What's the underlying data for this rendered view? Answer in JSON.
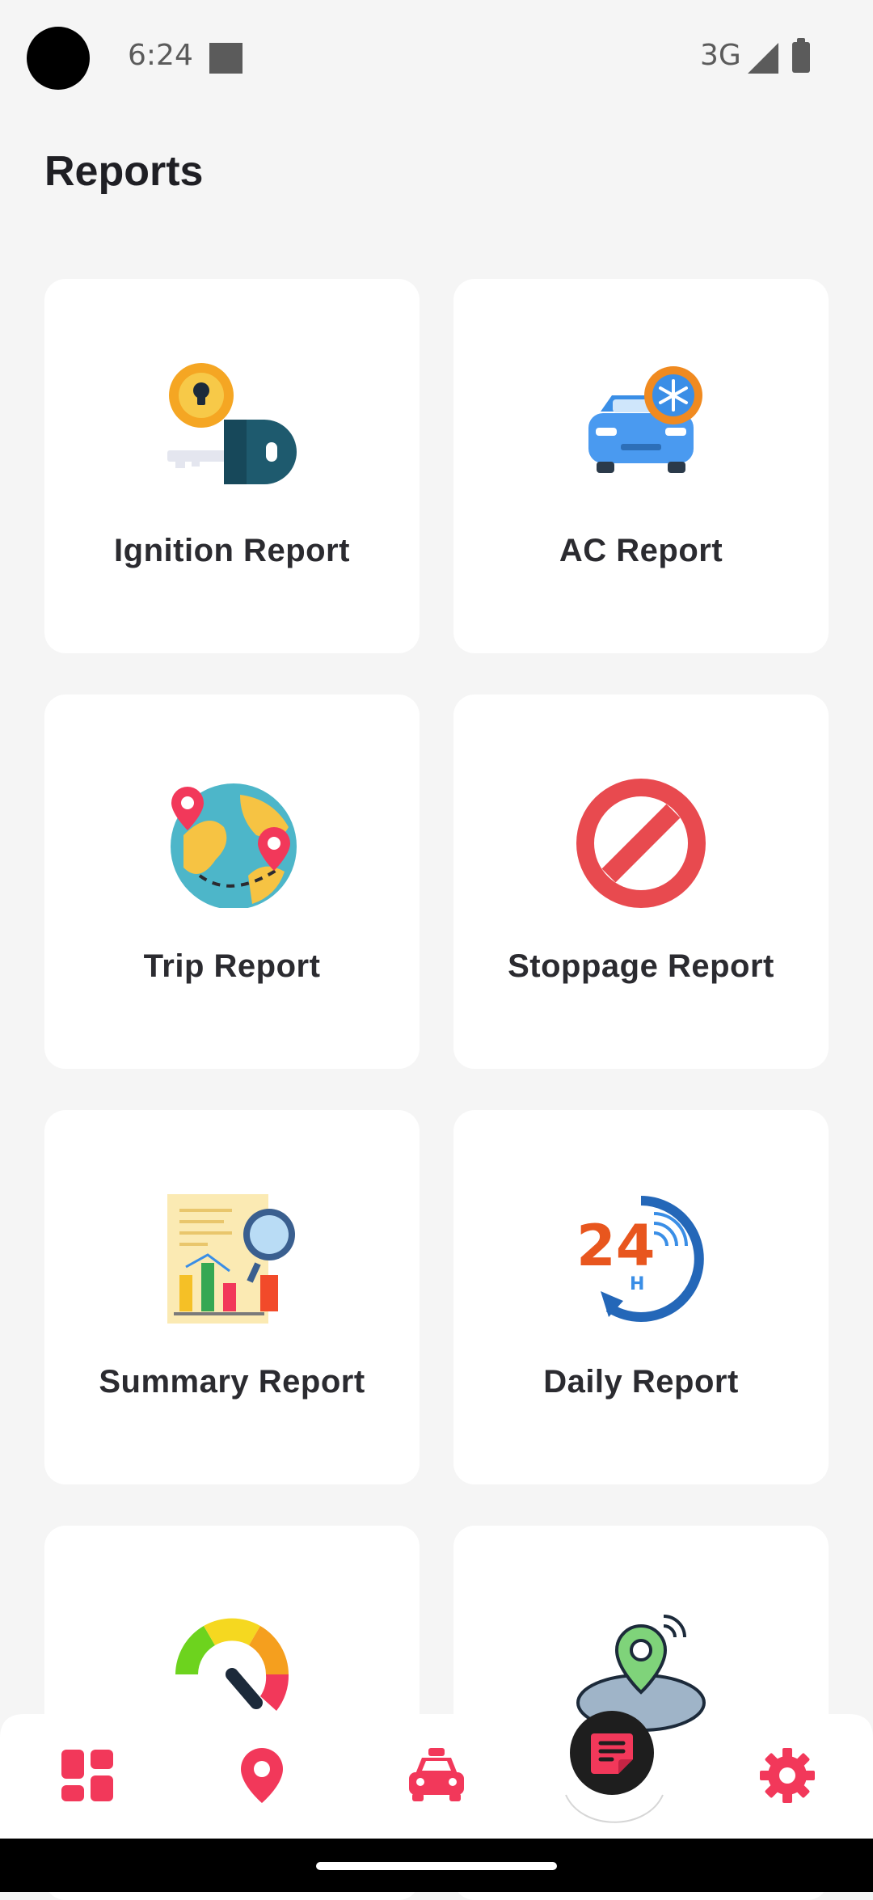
{
  "status_bar": {
    "time": "6:24",
    "network": "3G"
  },
  "page": {
    "title": "Reports"
  },
  "reports": [
    {
      "label": "Ignition Report",
      "icon": "ignition-key-icon"
    },
    {
      "label": "AC Report",
      "icon": "car-ac-icon"
    },
    {
      "label": "Trip Report",
      "icon": "globe-route-icon"
    },
    {
      "label": "Stoppage Report",
      "icon": "stop-sign-icon"
    },
    {
      "label": "Summary Report",
      "icon": "summary-chart-icon"
    },
    {
      "label": "Daily Report",
      "icon": "24-hour-icon"
    },
    {
      "label": "",
      "icon": "speedometer-icon"
    },
    {
      "label": "",
      "icon": "geofence-pin-icon"
    }
  ],
  "bottom_nav": [
    {
      "name": "dashboard",
      "icon": "dashboard-icon"
    },
    {
      "name": "location",
      "icon": "location-pin-icon"
    },
    {
      "name": "vehicles",
      "icon": "car-icon"
    },
    {
      "name": "reports",
      "icon": "report-note-icon",
      "active": true
    },
    {
      "name": "settings",
      "icon": "gear-icon"
    }
  ],
  "colors": {
    "accent": "#f2385a",
    "background": "#f5f5f5",
    "card": "#ffffff",
    "fab": "#1e1e1e"
  }
}
